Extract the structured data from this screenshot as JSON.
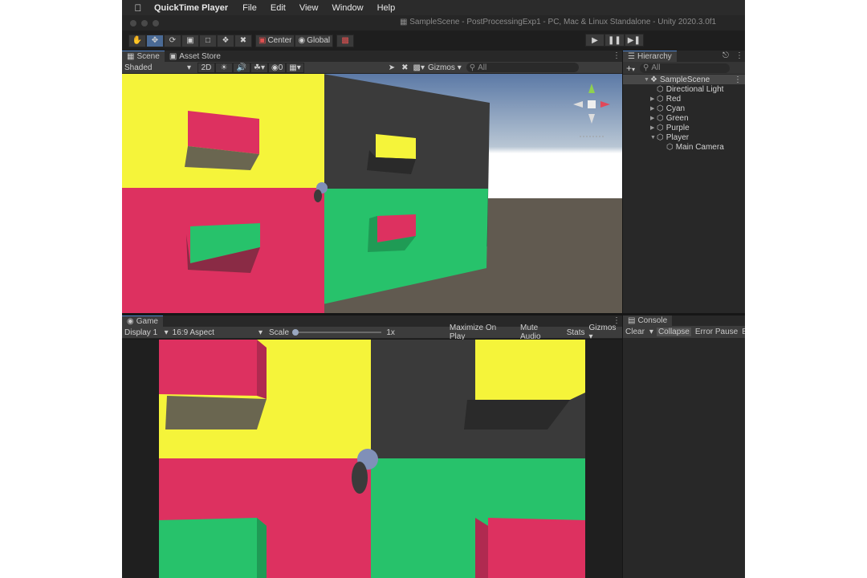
{
  "menubar": {
    "app_name": "QuickTime Player",
    "items": [
      "File",
      "Edit",
      "View",
      "Window",
      "Help"
    ]
  },
  "window": {
    "title": "SampleScene - PostProcessingExp1 - PC, Mac & Linux Standalone - Unity 2020.3.0f1"
  },
  "toolbar": {
    "tools": [
      "hand-tool-icon",
      "move-tool-icon",
      "rotate-tool-icon",
      "scale-tool-icon",
      "rect-tool-icon",
      "transform-tool-icon",
      "custom-tool-icon"
    ],
    "pivot_label": "Center",
    "space_label": "Global",
    "play_controls": [
      "play-icon",
      "pause-icon",
      "step-icon"
    ]
  },
  "scene_panel": {
    "tabs": [
      "Scene",
      "Asset Store"
    ],
    "shading_mode": "Shaded",
    "mode_2d_label": "2D",
    "gizmos_label": "Gizmos",
    "search_placeholder": "All",
    "layer_count": "0"
  },
  "hierarchy": {
    "tab_label": "Hierarchy",
    "search_placeholder": "All",
    "scene_name": "SampleScene",
    "items": [
      {
        "label": "Directional Light",
        "expandable": false,
        "depth": 1
      },
      {
        "label": "Red",
        "expandable": true,
        "depth": 1
      },
      {
        "label": "Cyan",
        "expandable": true,
        "depth": 1
      },
      {
        "label": "Green",
        "expandable": true,
        "depth": 1
      },
      {
        "label": "Purple",
        "expandable": true,
        "depth": 1
      },
      {
        "label": "Player",
        "expandable": true,
        "expanded": true,
        "depth": 1
      },
      {
        "label": "Main Camera",
        "expandable": false,
        "depth": 2
      }
    ]
  },
  "game_panel": {
    "tab_label": "Game",
    "display_label": "Display 1",
    "aspect_label": "16:9 Aspect",
    "scale_label": "Scale",
    "scale_value": "1x",
    "maximize_label": "Maximize On Play",
    "mute_label": "Mute Audio",
    "stats_label": "Stats",
    "gizmos_label": "Gizmos"
  },
  "console": {
    "tab_label": "Console",
    "clear_label": "Clear",
    "collapse_label": "Collapse",
    "error_pause_label": "Error Pause",
    "editor_label": "E"
  },
  "colors": {
    "yellow": "#f5f43a",
    "red": "#dd3160",
    "green": "#27c26b",
    "dark_wall": "#3a3a3a",
    "accent": "#4c7fc4"
  }
}
